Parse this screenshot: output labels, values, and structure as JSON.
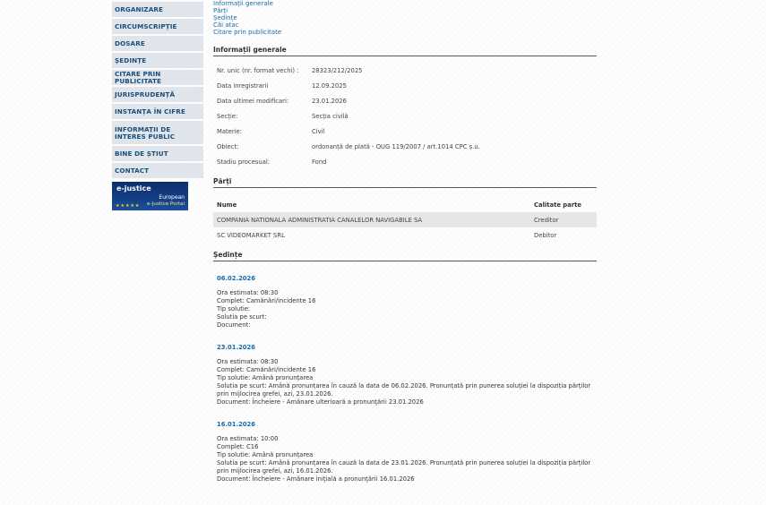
{
  "sidebar": {
    "items": [
      {
        "label": "ORGANIZARE"
      },
      {
        "label": "CIRCUMSCRIPȚIE"
      },
      {
        "label": "DOSARE"
      },
      {
        "label": "ȘEDINȚE"
      },
      {
        "label": "CITARE PRIN PUBLICITATE"
      },
      {
        "label": "JURISPRUDENȚĂ"
      },
      {
        "label": "INSTANȚA ÎN CIFRE"
      },
      {
        "label": "INFORMAȚII DE INTERES PUBLIC"
      },
      {
        "label": "BINE DE ȘTIUT"
      },
      {
        "label": "CONTACT"
      }
    ],
    "banner": {
      "line1": "e-justice",
      "line2": "European",
      "line3": "e-Justice Portal"
    }
  },
  "toplinks": [
    "Informații generale",
    "Părți",
    "Ședințe",
    "Căi atac",
    "Citare prin publicitate"
  ],
  "info": {
    "title": "Informații generale",
    "rows": [
      {
        "label": "Nr. unic (nr. format vechi) :",
        "value": "28323/212/2025"
      },
      {
        "label": "Data inregistrarii",
        "value": "12.09.2025"
      },
      {
        "label": "Data ultimei modificari:",
        "value": "23.01.2026"
      },
      {
        "label": "Secție:",
        "value": "Secția civilă"
      },
      {
        "label": "Materie:",
        "value": "Civil"
      },
      {
        "label": "Obiect:",
        "value": "ordonanță de plată - OUG 119/2007 / art.1014 CPC ș.u."
      },
      {
        "label": "Stadiu procesual:",
        "value": "Fond"
      }
    ]
  },
  "parti": {
    "title": "Părți",
    "headers": {
      "name": "Nume",
      "role": "Calitate parte"
    },
    "rows": [
      {
        "name": "COMPANIA NATIONALA ADMINISTRATIA CANALELOR NAVIGABILE SA",
        "role": "Creditor"
      },
      {
        "name": "SC VIDEOMARKET SRL",
        "role": "Debitor"
      }
    ]
  },
  "sedinte": {
    "title": "Ședințe",
    "items": [
      {
        "date": "06.02.2026",
        "ora": "Ora estimata: 08:30",
        "complet": "Complet: Camănări/incidente 16",
        "tip": "Tip solutie:",
        "solutie": "Solutia pe scurt:",
        "document": "Document:"
      },
      {
        "date": "23.01.2026",
        "ora": "Ora estimata: 08:30",
        "complet": "Complet: Camănări/incidente 16",
        "tip": "Tip solutie: Amână pronunțarea",
        "solutie": "Solutia pe scurt: Amână pronunțarea în cauză la data de 06.02.2026. Pronunțată prin punerea soluției la dispoziția părților prin mijlocirea grefei, azi, 23.01.2026.",
        "document": "Document: Încheiere - Amânare ulterioară a pronunţării    23.01.2026"
      },
      {
        "date": "16.01.2026",
        "ora": "Ora estimata: 10:00",
        "complet": "Complet: C16",
        "tip": "Tip solutie: Amână pronunțarea",
        "solutie": "Solutia pe scurt: Amână pronunțarea în cauză la data de 23.01.2026. Pronunțată prin punerea soluției la dispoziția părților prin mijlocirea grefei, azi, 16.01.2026.",
        "document": "Document: Încheiere - Amânare iniţială a pronunţării    16.01.2026"
      }
    ]
  }
}
